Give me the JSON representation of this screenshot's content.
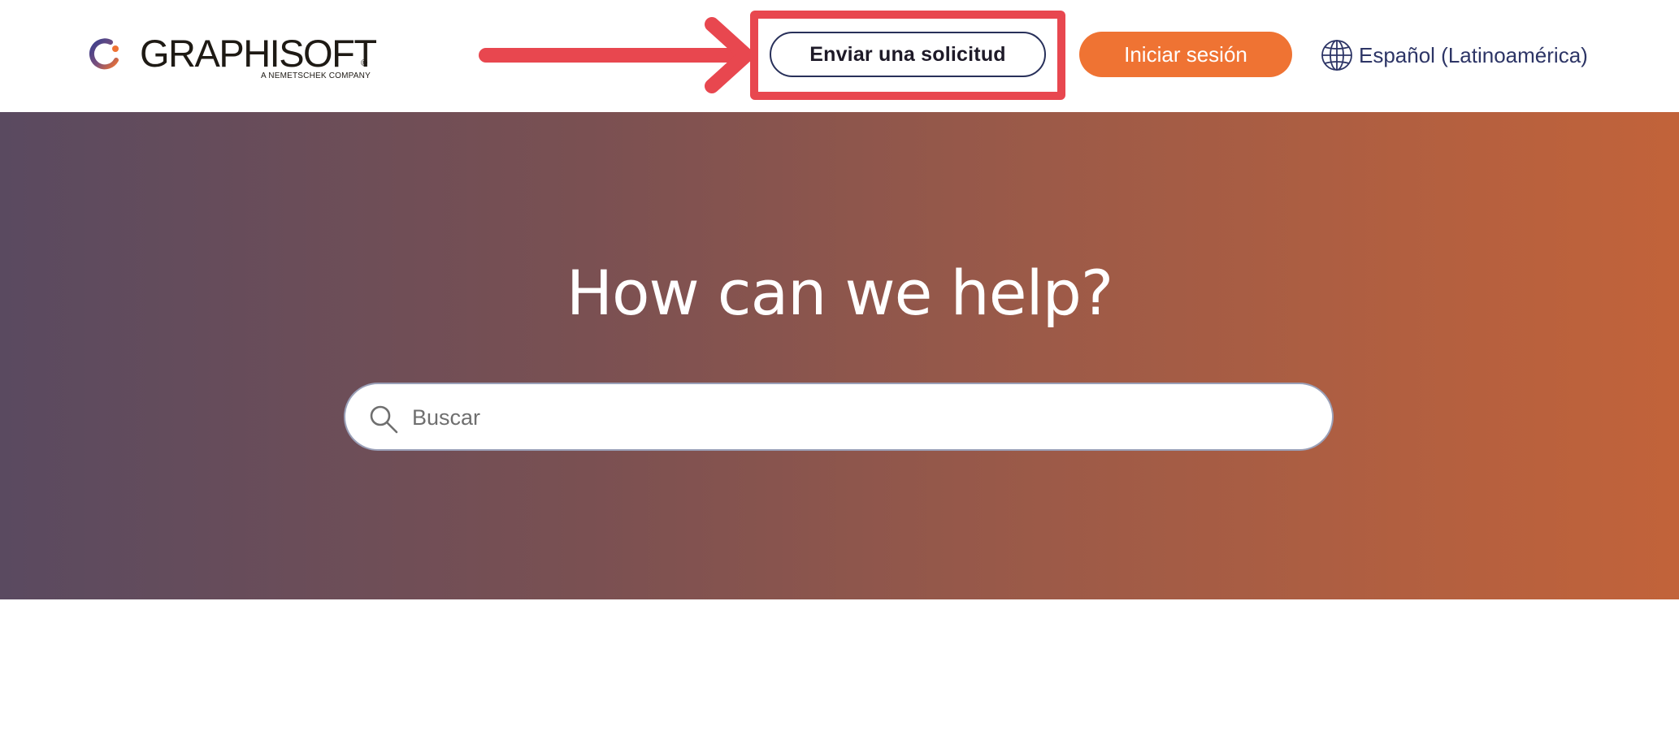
{
  "header": {
    "logo": {
      "wordmark": "GRAPHISOFT",
      "registered": "®",
      "tagline": "A NEMETSCHEK COMPANY"
    },
    "request_button_label": "Enviar una solicitud",
    "login_button_label": "Iniciar sesión",
    "language_label": "Español (Latinoamérica)"
  },
  "hero": {
    "title": "How can we help?",
    "search": {
      "placeholder": "Buscar",
      "value": ""
    }
  },
  "colors": {
    "accent_orange": "#ef7333",
    "annotation_red": "#e8474f",
    "navy": "#28305a",
    "hero_gradient_start": "#5a4a60",
    "hero_gradient_end": "#c2633a"
  },
  "icons": {
    "logo_mark": "graphisoft-logo-icon",
    "language": "globe-icon",
    "search": "search-icon",
    "annotation": "arrow-right-icon"
  }
}
